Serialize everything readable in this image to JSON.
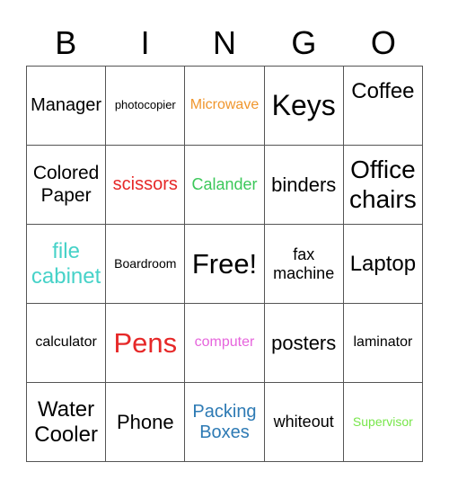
{
  "header": {
    "letters": [
      "B",
      "I",
      "N",
      "G",
      "O"
    ]
  },
  "colors": {
    "black": "#000000",
    "orange": "#f0962d",
    "red": "#e62828",
    "green": "#3cc85a",
    "teal": "#46d2c8",
    "pink": "#e664dc",
    "blue": "#2d7ab4",
    "lime": "#78e64b"
  },
  "cells": [
    {
      "text": "Manager",
      "color": "#000000"
    },
    {
      "text": "photocopier",
      "color": "#000000"
    },
    {
      "text": "Microwave",
      "color": "#f0962d"
    },
    {
      "text": "Keys",
      "color": "#000000"
    },
    {
      "text": "Coffee",
      "color": "#000000"
    },
    {
      "text": "Colored Paper",
      "color": "#000000"
    },
    {
      "text": "scissors",
      "color": "#e62828"
    },
    {
      "text": "Calander",
      "color": "#3cc85a"
    },
    {
      "text": "binders",
      "color": "#000000"
    },
    {
      "text": "Office chairs",
      "color": "#000000"
    },
    {
      "text": "file cabinet",
      "color": "#46d2c8"
    },
    {
      "text": "Boardroom",
      "color": "#000000"
    },
    {
      "text": "Free!",
      "color": "#000000"
    },
    {
      "text": "fax machine",
      "color": "#000000"
    },
    {
      "text": "Laptop",
      "color": "#000000"
    },
    {
      "text": "calculator",
      "color": "#000000"
    },
    {
      "text": "Pens",
      "color": "#e62828"
    },
    {
      "text": "computer",
      "color": "#e664dc"
    },
    {
      "text": "posters",
      "color": "#000000"
    },
    {
      "text": "laminator",
      "color": "#000000"
    },
    {
      "text": "Water Cooler",
      "color": "#000000"
    },
    {
      "text": "Phone",
      "color": "#000000"
    },
    {
      "text": "Packing Boxes",
      "color": "#2d7ab4"
    },
    {
      "text": "whiteout",
      "color": "#000000"
    },
    {
      "text": "Supervisor",
      "color": "#78e64b"
    }
  ]
}
